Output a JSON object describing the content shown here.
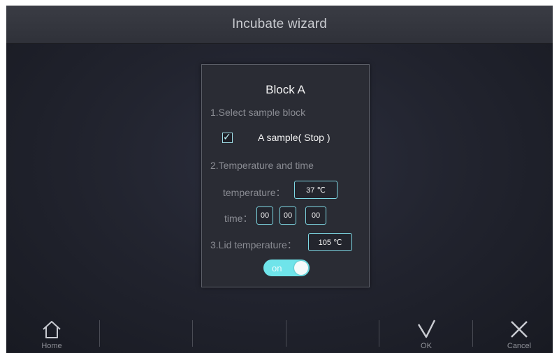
{
  "header": {
    "title": "Incubate wizard"
  },
  "dialog": {
    "block_title": "Block A",
    "step1": "1.Select sample block",
    "sample_label": "A sample( Stop )",
    "sample_checked": true,
    "step2": "2.Temperature and time",
    "temperature_label": "temperature：",
    "temperature_value": "37 ℃",
    "time_label": "time：",
    "time_hours": "00",
    "time_minutes": "00",
    "time_seconds": "00",
    "step3": "3.Lid temperature：",
    "lid_temperature_value": "105 ℃",
    "lid_toggle_label": "on",
    "lid_toggle_on": true
  },
  "footer": {
    "home_label": "Home",
    "ok_label": "OK",
    "cancel_label": "Cancel"
  },
  "icons": {
    "home": "home-icon",
    "ok": "checkmark-icon",
    "cancel": "close-icon"
  },
  "colors": {
    "accent": "#7ed8e4",
    "toggle_on": "#6fe4ea"
  }
}
